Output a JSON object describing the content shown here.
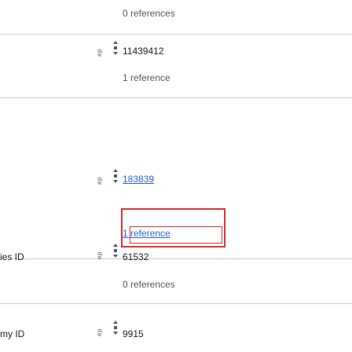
{
  "statements": [
    {
      "property_label": "",
      "value": "",
      "references_text": "0 references"
    },
    {
      "property_label": "",
      "value": "11439412",
      "references_text": "1 reference"
    },
    {
      "property_label": "",
      "value": "183839",
      "references_text": "1 reference"
    },
    {
      "property_label": "ies ID",
      "value": "61532",
      "references_text": "0 references"
    },
    {
      "property_label": "my ID",
      "value": "9915",
      "references_text": ""
    }
  ],
  "edit_tag_label": "ep",
  "colors": {
    "link": "#3366cc",
    "border": "#c8ccd1",
    "highlight": "#dd3333"
  }
}
